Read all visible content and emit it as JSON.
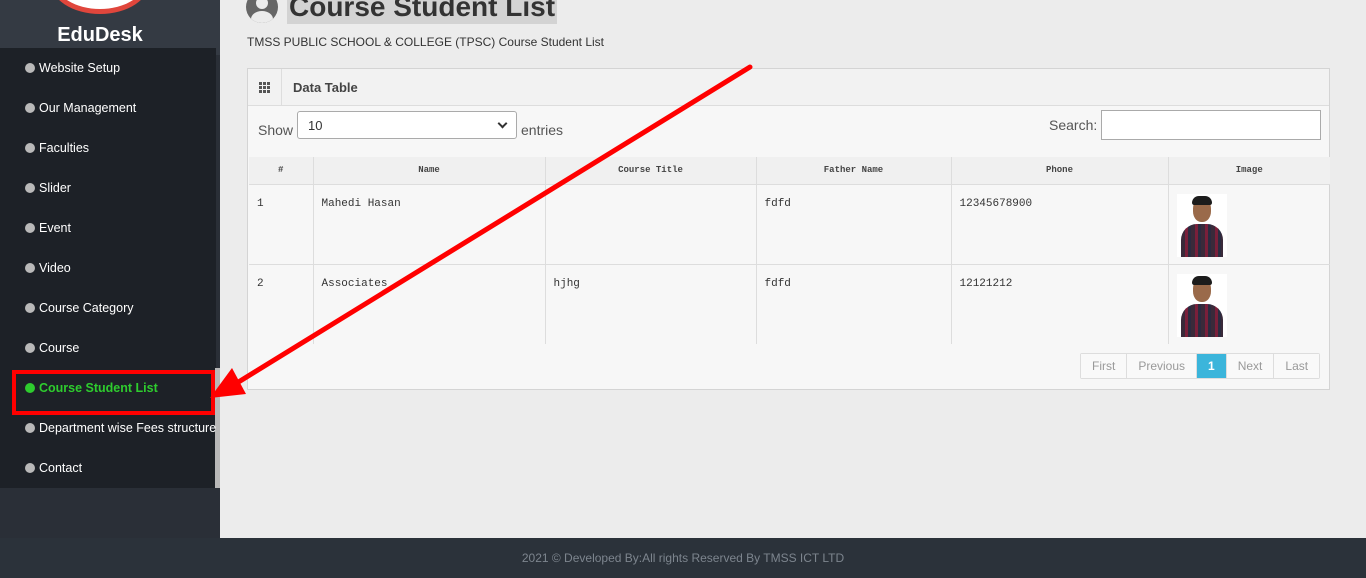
{
  "brand": "EduDesk",
  "menu": {
    "items": [
      {
        "label": "Website Setup"
      },
      {
        "label": "Our Management"
      },
      {
        "label": "Faculties"
      },
      {
        "label": "Slider"
      },
      {
        "label": "Event"
      },
      {
        "label": "Video"
      },
      {
        "label": "Course Category"
      },
      {
        "label": "Course"
      },
      {
        "label": "Course Student List"
      },
      {
        "label": "Department wise Fees structure"
      },
      {
        "label": "Contact"
      }
    ]
  },
  "page": {
    "title": "Course Student List",
    "subtitle": "TMSS PUBLIC SCHOOL & COLLEGE (TPSC) Course Student List"
  },
  "panel": {
    "title": "Data Table",
    "show_label": "Show",
    "entries_value": "10",
    "entries_label": "entries",
    "search_label": "Search:",
    "search_value": ""
  },
  "table": {
    "headers": [
      "#",
      "Name",
      "Course Title",
      "Father Name",
      "Phone",
      "Image"
    ],
    "rows": [
      [
        "1",
        "Mahedi Hasan",
        "",
        "fdfd",
        "12345678900"
      ],
      [
        "2",
        "Associates",
        "hjhg",
        "fdfd",
        "12121212"
      ]
    ]
  },
  "pagination": {
    "first": "First",
    "previous": "Previous",
    "current": "1",
    "next": "Next",
    "last": "Last"
  },
  "footer": "2021 © Developed By:All rights Reserved By TMSS ICT LTD",
  "colors": {
    "sidebar": "#1d2127",
    "active_menu": "#2ecc2e",
    "annotation": "#ff0000",
    "pagination_active": "#3bb5db"
  },
  "icons": [
    "user-circle-icon",
    "grid-icon",
    "chevron-down-icon",
    "bullet-dot-icon"
  ]
}
